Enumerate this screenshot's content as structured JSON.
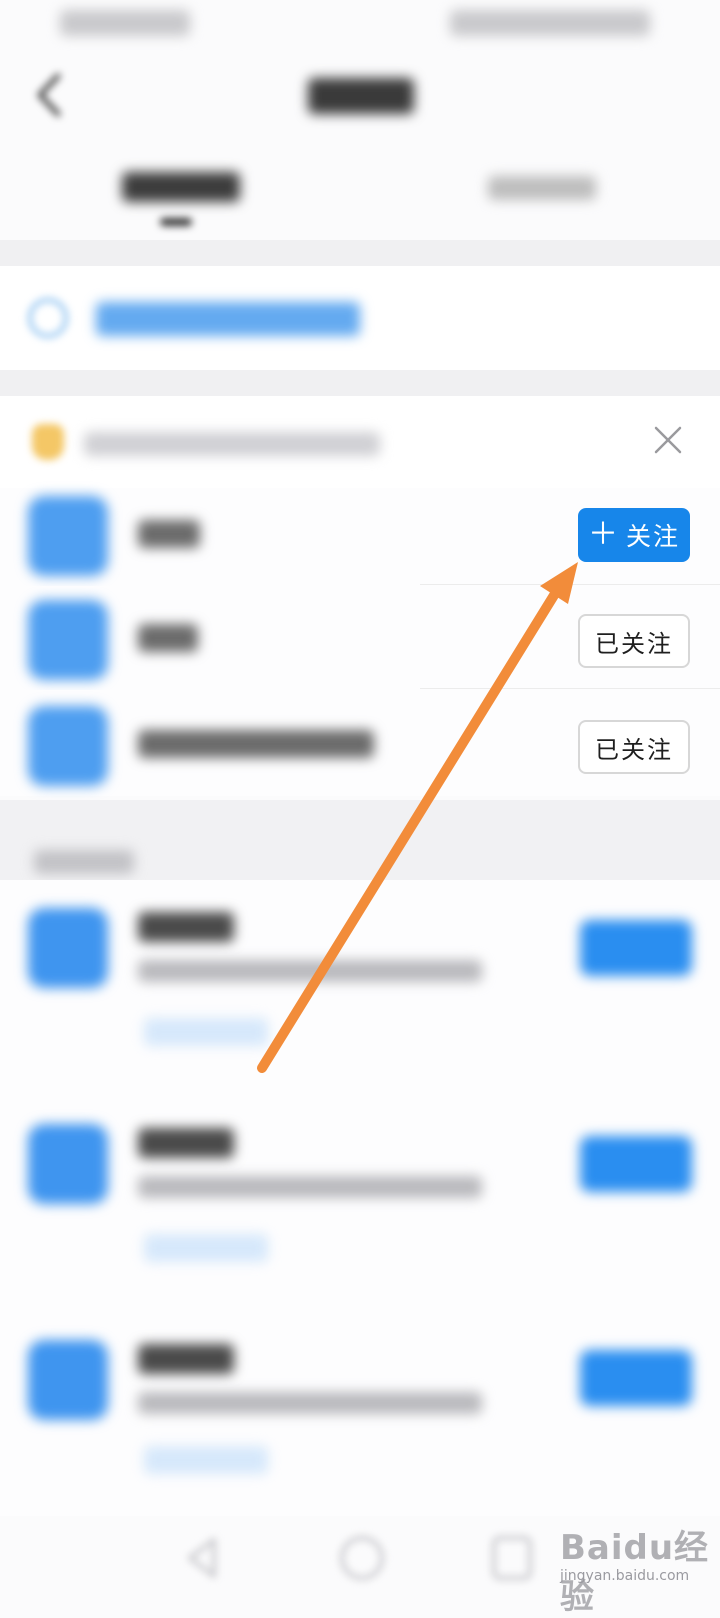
{
  "followed_list": {
    "items": [
      {
        "button_label": "关注",
        "button_prefix": "＋",
        "state": "unfollowed"
      },
      {
        "button_label": "已关注",
        "state": "followed"
      },
      {
        "button_label": "已关注",
        "state": "followed"
      }
    ]
  },
  "watermark": {
    "logo_text": "Baidu经验",
    "subtext": "jingyan.baidu.com"
  },
  "annotation": {
    "arrow_color": "#f28c3a",
    "target": "follow-button"
  },
  "colors": {
    "accent_blue": "#1786ea",
    "avatar_blue": "#4e9ef0"
  }
}
